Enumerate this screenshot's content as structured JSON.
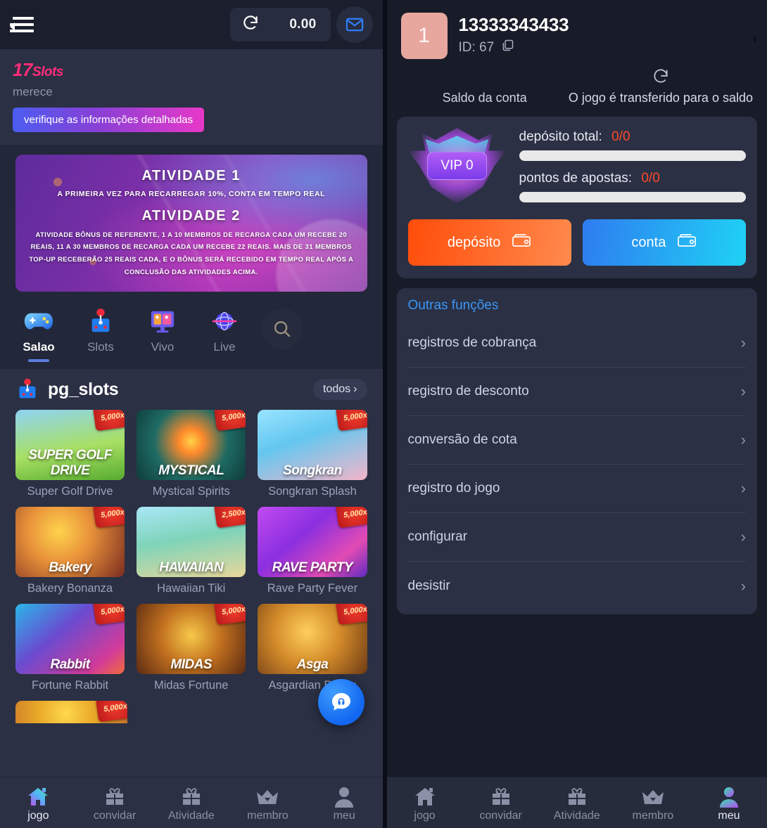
{
  "left": {
    "topbar": {
      "menu_icon": "hamburger-menu-icon",
      "refresh_icon": "refresh-icon",
      "balance": "0.00",
      "mail_icon": "mail-icon"
    },
    "promo": {
      "count": "17",
      "count_suffix": "Slots",
      "subtitle": "merece",
      "button": "verifique as informações detalhadas"
    },
    "banner": {
      "heading1": "ATIVIDADE 1",
      "line1": "A PRIMEIRA VEZ PARA RECARREGAR 10%, CONTA EM TEMPO REAL",
      "heading2": "ATIVIDADE 2",
      "paragraph": "ATIVIDADE BÔNUS DE REFERENTE, 1 A 10 MEMBROS DE RECARGA CADA UM RECEBE 20 REAIS, 11 A 30 MEMBROS DE RECARGA CADA UM RECEBE 22 REAIS. MAIS DE 31 MEMBROS TOP-UP RECEBERÃO 25 REAIS CADA, E O BÔNUS SERÁ RECEBIDO EM TEMPO REAL APÓS A CONCLUSÃO DAS ATIVIDADES ACIMA."
    },
    "categories": [
      {
        "label": "Salao",
        "icon": "gamepad-icon",
        "glyph": "🎮",
        "active": true
      },
      {
        "label": "Slots",
        "icon": "slot-machine-icon",
        "glyph": "🎰",
        "active": false
      },
      {
        "label": "Vivo",
        "icon": "live-dealer-icon",
        "glyph": "🎴",
        "active": false
      },
      {
        "label": "Live",
        "icon": "globe-icon",
        "glyph": "🌐",
        "active": false
      }
    ],
    "search_icon": "search-icon",
    "games": {
      "provider_icon": "pg-provider-icon",
      "provider": "pg_slots",
      "all_label": "todos",
      "items": [
        {
          "name": "Super Golf Drive",
          "art": "th-golf",
          "multiplier": "5,000x",
          "art_text": "SUPER GOLF DRIVE"
        },
        {
          "name": "Mystical Spirits",
          "art": "th-myst",
          "multiplier": "5,000x",
          "art_text": "MYSTICAL"
        },
        {
          "name": "Songkran Splash",
          "art": "th-song",
          "multiplier": "5,000x",
          "art_text": "Songkran"
        },
        {
          "name": "Bakery Bonanza",
          "art": "th-bake",
          "multiplier": "5,000x",
          "art_text": "Bakery"
        },
        {
          "name": "Hawaiian Tiki",
          "art": "th-hawa",
          "multiplier": "2,500x",
          "art_text": "HAWAIIAN"
        },
        {
          "name": "Rave Party Fever",
          "art": "th-rave",
          "multiplier": "5,000x",
          "art_text": "RAVE PARTY"
        },
        {
          "name": "Fortune Rabbit",
          "art": "th-rabb",
          "multiplier": "5,000x",
          "art_text": "Rabbit"
        },
        {
          "name": "Midas Fortune",
          "art": "th-mida",
          "multiplier": "5,000x",
          "art_text": "MIDAS"
        },
        {
          "name": "Asgardian Rising",
          "art": "th-asga",
          "multiplier": "5,000x",
          "art_text": "Asga"
        }
      ],
      "partial_item": {
        "name": "",
        "art": "th-gold",
        "multiplier": "5,000x"
      }
    },
    "fab_icon": "support-chat-icon",
    "bottom_nav": [
      {
        "label": "jogo",
        "icon": "home-icon",
        "glyph": "home",
        "active": true
      },
      {
        "label": "convidar",
        "icon": "gift-icon",
        "glyph": "gift",
        "active": false
      },
      {
        "label": "Atividade",
        "icon": "gift-icon",
        "glyph": "gift",
        "active": false
      },
      {
        "label": "membro",
        "icon": "crown-icon",
        "glyph": "crown",
        "active": false
      },
      {
        "label": "meu",
        "icon": "person-icon",
        "glyph": "person",
        "active": false
      }
    ]
  },
  "right": {
    "avatar_text": "1",
    "username": "13333343433",
    "id_label": "ID: 67",
    "copy_icon": "copy-icon",
    "back_icon": "back-caret-icon",
    "balance_label": "Saldo da conta",
    "transfer_icon": "refresh-icon",
    "transfer_label": "O jogo é transferido para o saldo",
    "vip": {
      "badge_icon": "vip-crown-icon",
      "level": "VIP 0",
      "deposit_label": "depósito total:",
      "deposit_value": "0/0",
      "points_label": "pontos de apostas:",
      "points_value": "0/0"
    },
    "buttons": {
      "deposit": "depósito",
      "account": "conta",
      "wallet_icon": "wallet-icon"
    },
    "functions": {
      "title": "Outras funções",
      "items": [
        {
          "label": "registros de cobrança"
        },
        {
          "label": "registro de desconto"
        },
        {
          "label": "conversão de cota"
        },
        {
          "label": "registro do jogo"
        },
        {
          "label": "configurar"
        },
        {
          "label": "desistir"
        }
      ]
    },
    "bottom_nav": [
      {
        "label": "jogo",
        "icon": "home-icon",
        "glyph": "home",
        "active": false
      },
      {
        "label": "convidar",
        "icon": "gift-icon",
        "glyph": "gift",
        "active": false
      },
      {
        "label": "Atividade",
        "icon": "gift-icon",
        "glyph": "gift",
        "active": false
      },
      {
        "label": "membro",
        "icon": "crown-icon",
        "glyph": "crown",
        "active": false
      },
      {
        "label": "meu",
        "icon": "person-icon",
        "glyph": "person",
        "active": true
      }
    ]
  },
  "colors": {
    "panel_bg": "#2b3044",
    "panel_dark": "#181c29",
    "accent_pink": "#ff2d78",
    "accent_blue": "#3b97f7",
    "value_red": "#ff4a2b",
    "deposit_orange": "#ff4d0a",
    "account_blue": "#2e7cf0"
  }
}
